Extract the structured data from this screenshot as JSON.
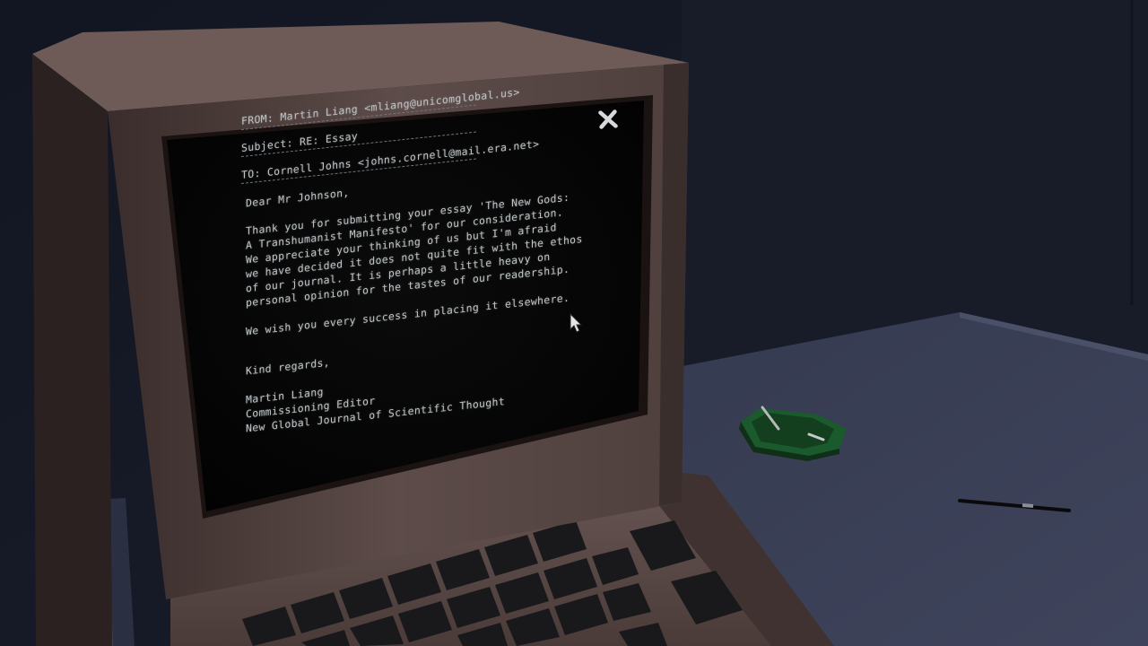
{
  "email": {
    "from": "FROM: Martin Liang <mliang@unicomglobal.us>",
    "subject": "Subject: RE: Essay",
    "to": "TO: Cornell Johns <johns.cornell@mail.era.net>",
    "salutation": "Dear Mr Johnson,",
    "body_lines": [
      "Thank you for submitting your essay 'The New Gods:",
      "A Transhumanist Manifesto' for our consideration.",
      "We appreciate your thinking of us but I'm afraid",
      "we have decided it does not quite fit with the ethos",
      "of our journal. It is perhaps a little heavy on",
      "personal opinion for the tastes of our readership."
    ],
    "wish": "We wish you every success in placing it elsewhere.",
    "closing": "Kind regards,",
    "signature": {
      "name": "Martin Liang",
      "title": "Commissioning Editor",
      "organization": "New Global Journal of Scientific Thought"
    }
  },
  "icons": {
    "close": "close-icon",
    "cursor": "mouse-pointer-icon"
  },
  "colors": {
    "screen_text": "#bfc3c6",
    "screen_bg": "#050505",
    "monitor_casing": "#5b4a47",
    "desk_surface": "#3b3f55",
    "ashtray": "#1f5a2d"
  }
}
